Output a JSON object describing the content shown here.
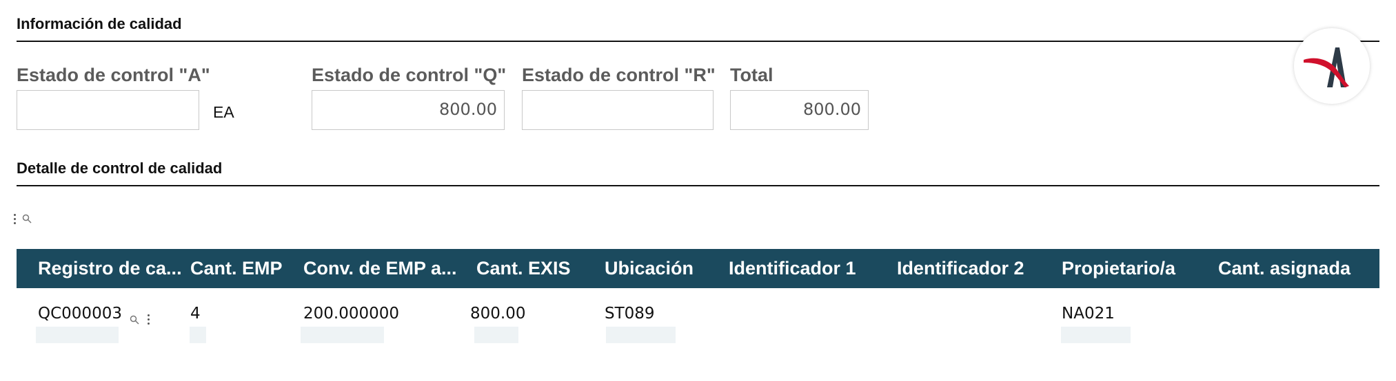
{
  "quality_info": {
    "title": "Información de calidad",
    "fields": [
      {
        "label": "Estado de control \"A\"",
        "value": ""
      },
      {
        "label": "Estado de control \"Q\"",
        "value": "800.00"
      },
      {
        "label": "Estado de control \"R\"",
        "value": ""
      },
      {
        "label": "Total",
        "value": "800.00"
      }
    ],
    "uom": "EA"
  },
  "quality_detail": {
    "title": "Detalle de control de calidad",
    "toolbar_icons": [
      "more-vertical-icon",
      "search-icon"
    ],
    "columns": [
      "Registro de ca...",
      "Cant. EMP",
      "Conv. de EMP a...",
      "Cant. EXIS",
      "Ubicación",
      "Identificador 1",
      "Identificador 2",
      "Propietario/a",
      "Cant. asignada"
    ],
    "rows": [
      {
        "registro": "QC000003",
        "cant_emp": "4",
        "conv_emp": "200.000000",
        "cant_exis": "800.00",
        "ubicacion": "ST089",
        "identificador1": "",
        "identificador2": "",
        "propietario": "NA021",
        "cant_asignada": ""
      }
    ]
  },
  "colors": {
    "header_bg": "#1b4a5e",
    "logo_red": "#d0102c",
    "logo_dark": "#2d3a47"
  }
}
